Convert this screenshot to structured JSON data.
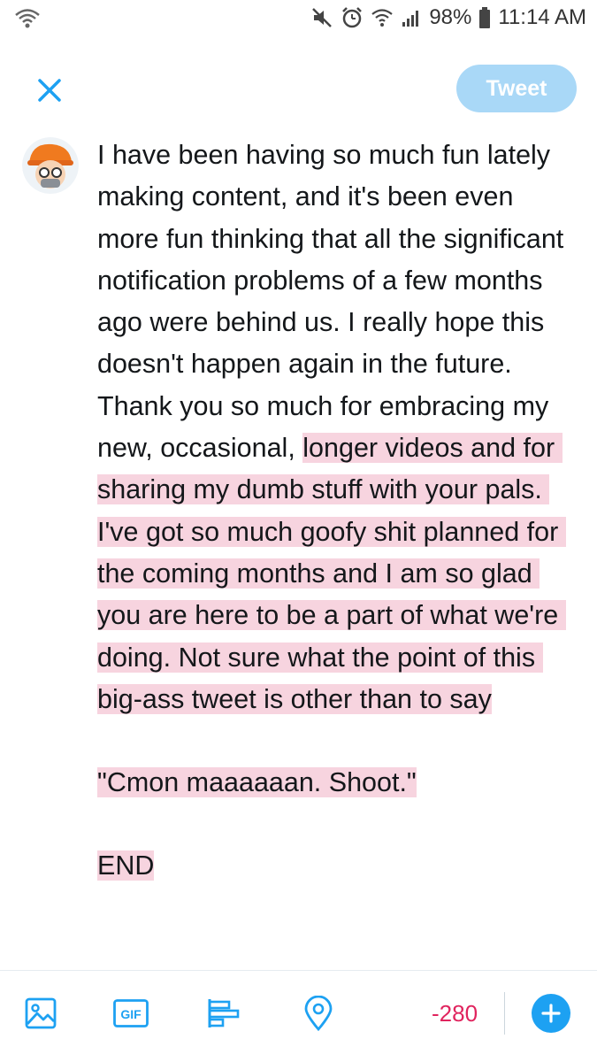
{
  "status_bar": {
    "battery": "98%",
    "time": "11:14 AM"
  },
  "header": {
    "tweet_button": "Tweet"
  },
  "tweet": {
    "seg1": "I have been having so much fun lately making content, and it's been even more fun thinking that all the significant notification problems of a few months ago were behind us. I really hope this doesn't happen again in the future. Thank you so much for embracing my new, occasional, ",
    "seg2": "longer videos and for sharing my dumb stuff with your pals. I've got so much goofy shit planned for the coming months and I am so glad you are here to be a part of what we're doing. Not sure what the point of this big-ass tweet is other than to say",
    "quote": "\"Cmon maaaaaan. Shoot.\"",
    "end": "END"
  },
  "toolbar": {
    "gif_label": "GIF",
    "char_counter": "-280",
    "icons": [
      "image-icon",
      "gif-icon",
      "poll-icon",
      "location-icon",
      "add-icon"
    ]
  },
  "colors": {
    "accent": "#1da1f2",
    "tweet_button_disabled": "#a9d8f7",
    "highlight": "#f7d4df",
    "over_limit": "#e0245e"
  }
}
